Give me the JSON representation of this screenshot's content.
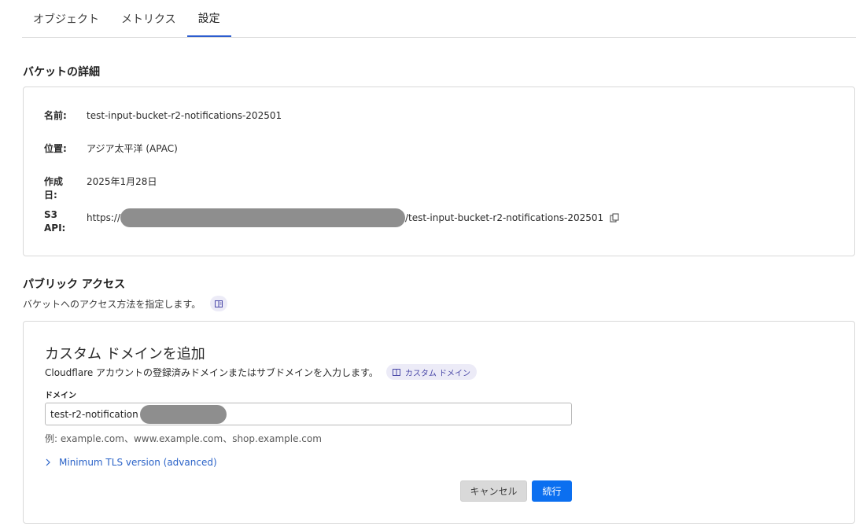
{
  "tabs": [
    {
      "label": "オブジェクト",
      "active": false
    },
    {
      "label": "メトリクス",
      "active": false
    },
    {
      "label": "設定",
      "active": true
    }
  ],
  "bucket_details": {
    "title": "バケットの詳細",
    "name_label": "名前:",
    "name_value": "test-input-bucket-r2-notifications-202501",
    "location_label": "位置:",
    "location_value": "アジア太平洋 (APAC)",
    "created_label": "作成日:",
    "created_value": "2025年1月28日",
    "s3_label": "S3 API:",
    "s3_prefix": "https://",
    "s3_suffix": "/test-input-bucket-r2-notifications-202501",
    "copy_icon": "copy-icon"
  },
  "public_access": {
    "title": "パブリック アクセス",
    "subtitle": "バケットへのアクセス方法を指定します。",
    "doc_icon": "book-icon"
  },
  "custom_domain": {
    "title": "カスタム ドメインを追加",
    "description": "Cloudflare アカウントの登録済みドメインまたはサブドメインを入力します。",
    "link_label": "カスタム ドメイン",
    "field_label": "ドメイン",
    "input_value": "test-r2-notification",
    "hint": "例: example.com、www.example.com、shop.example.com",
    "advanced_label": "Minimum TLS version (advanced)",
    "cancel_label": "キャンセル",
    "continue_label": "続行"
  },
  "colors": {
    "accent": "#2c5dcf",
    "primary_button": "#0b6ff0",
    "link": "#2b63c8",
    "pill_bg": "#ecebf7"
  }
}
